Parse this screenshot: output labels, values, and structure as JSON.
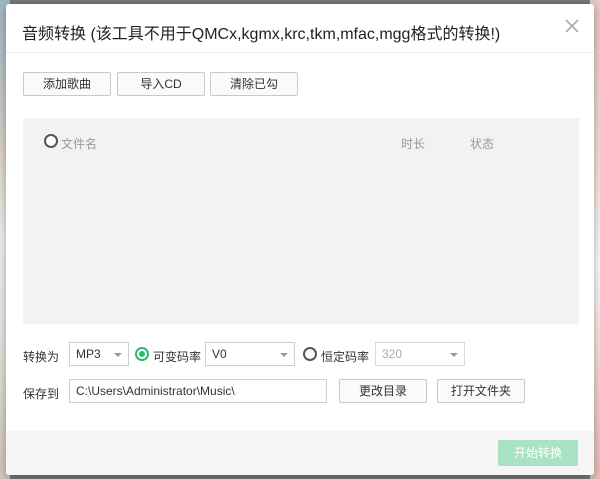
{
  "dialog": {
    "title": "音频转换 (该工具不用于QMCx,kgmx,krc,tkm,mfac,mgg格式的转换!)",
    "close_icon": "close-icon"
  },
  "toolbar": {
    "add_song": "添加歌曲",
    "import_cd": "导入CD",
    "clear_checked": "清除已勾"
  },
  "file_list": {
    "columns": [
      "文件名",
      "时长",
      "状态"
    ],
    "rows": []
  },
  "convert": {
    "label": "转换为",
    "format_value": "MP3",
    "vbr_label": "可变码率",
    "vbr_selected": true,
    "vbr_value": "V0",
    "cbr_label": "恒定码率",
    "cbr_selected": false,
    "cbr_value": "320"
  },
  "save": {
    "label": "保存到",
    "path": "C:\\Users\\Administrator\\Music\\",
    "change_dir": "更改目录",
    "open_folder": "打开文件夹"
  },
  "footer": {
    "start_label": "开始转换"
  },
  "colors": {
    "accent": "#2fb870",
    "start_disabled": "#a9e3c3"
  }
}
